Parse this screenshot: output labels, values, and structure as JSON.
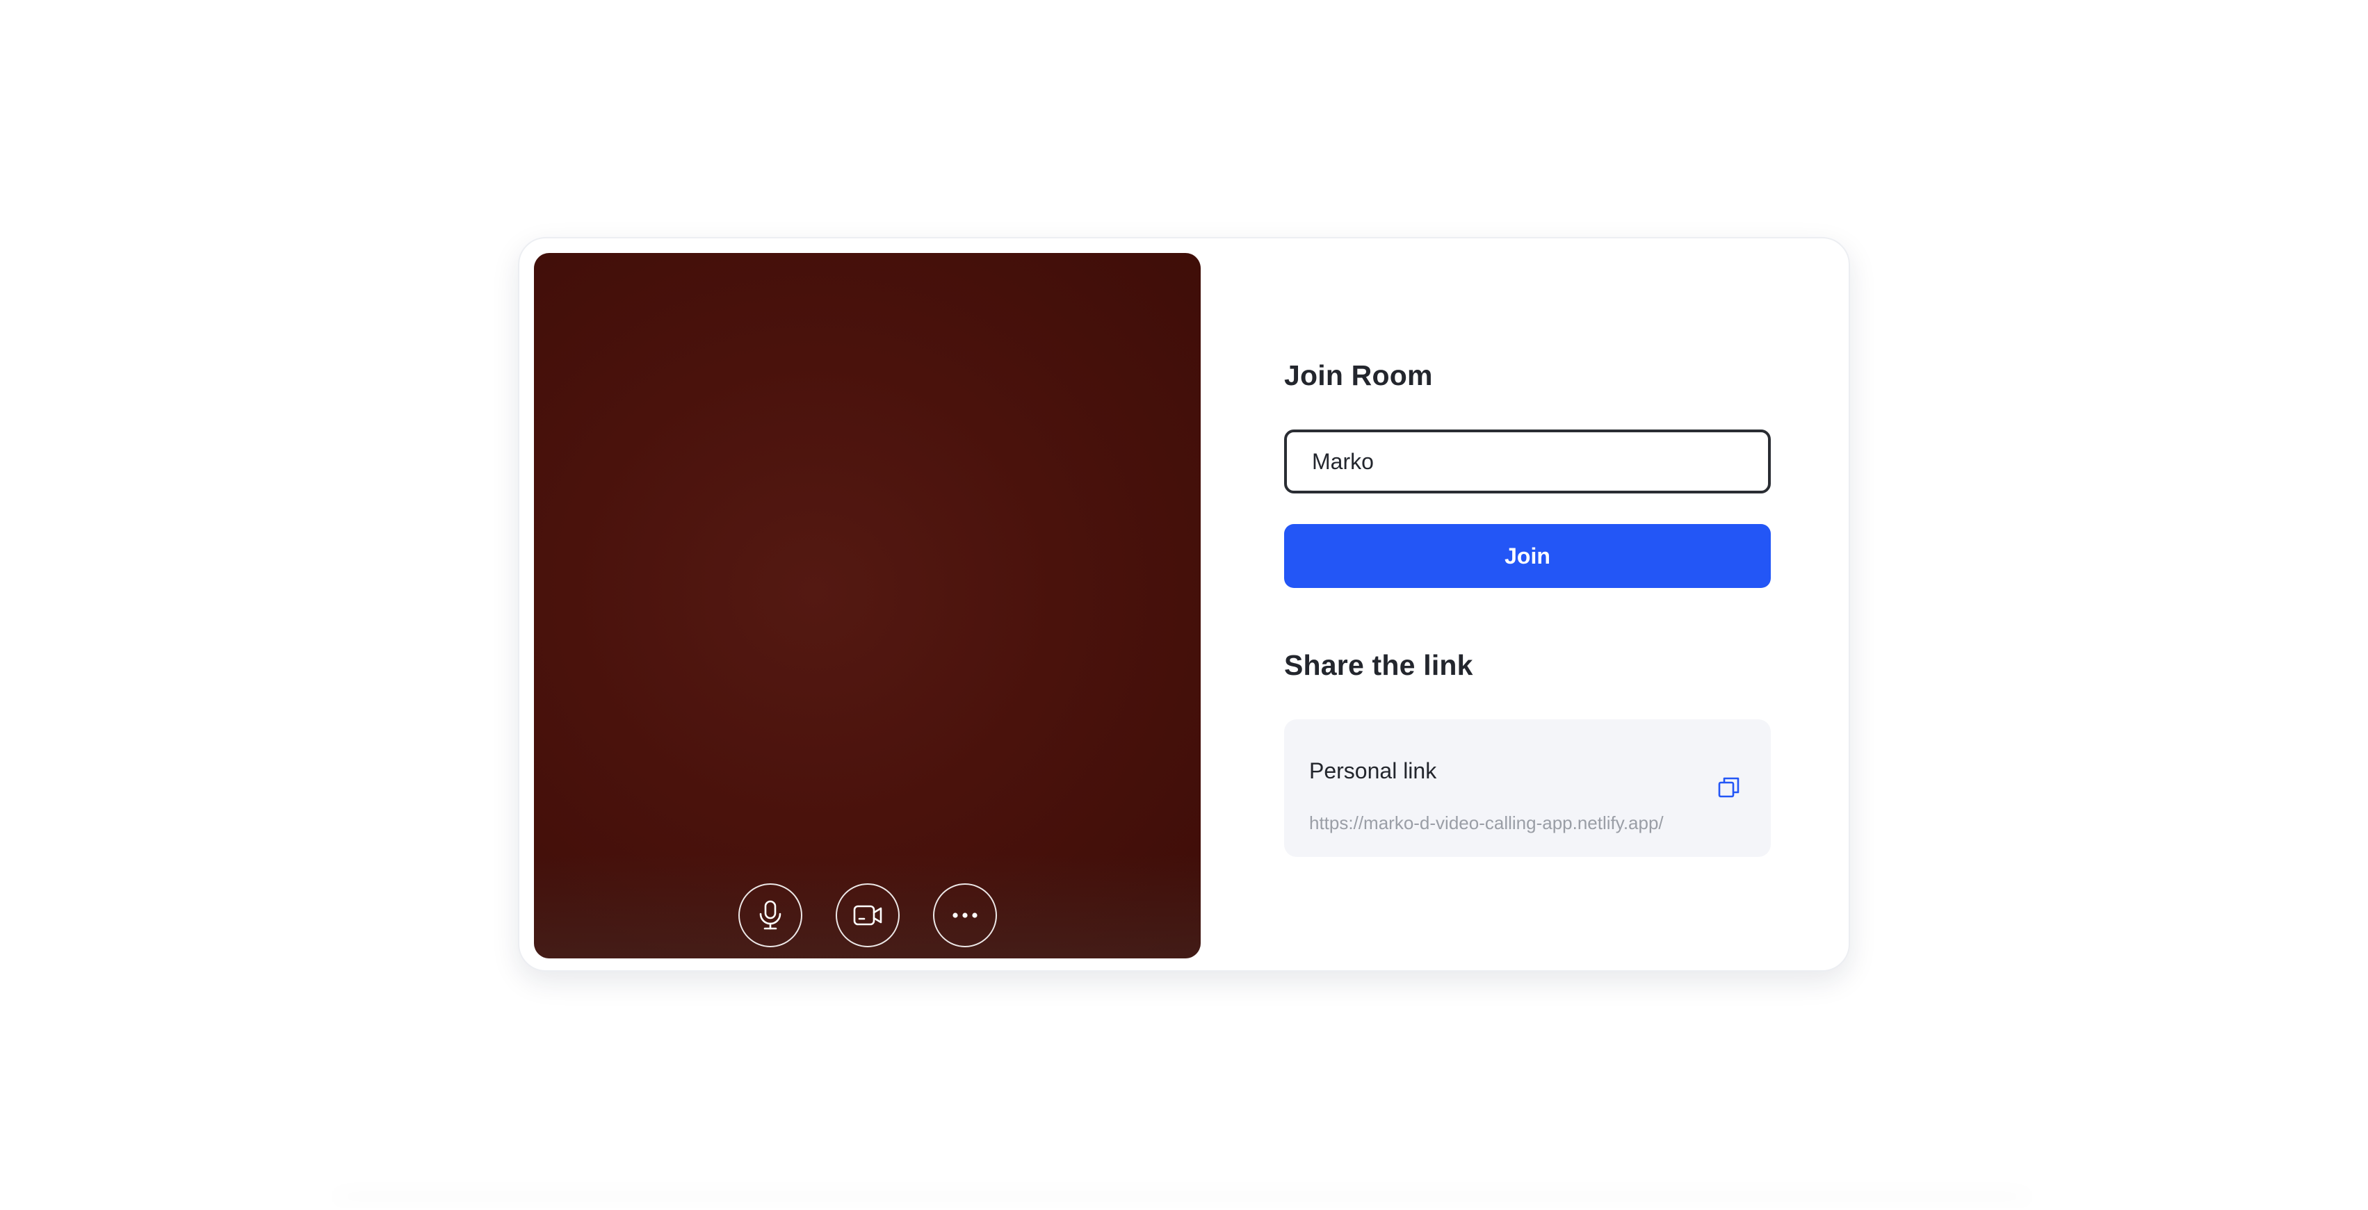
{
  "join_room": {
    "heading": "Join Room",
    "name_value": "Marko",
    "join_label": "Join"
  },
  "share": {
    "heading": "Share the link",
    "personal_link_label": "Personal link",
    "url": "https://marko-d-video-calling-app.netlify.app/"
  },
  "video": {
    "controls": [
      "microphone-icon",
      "camera-icon",
      "more-icon"
    ]
  },
  "colors": {
    "accent": "#2356f6",
    "video_background": "#4a120c",
    "link_box_bg": "#f4f5f9"
  }
}
